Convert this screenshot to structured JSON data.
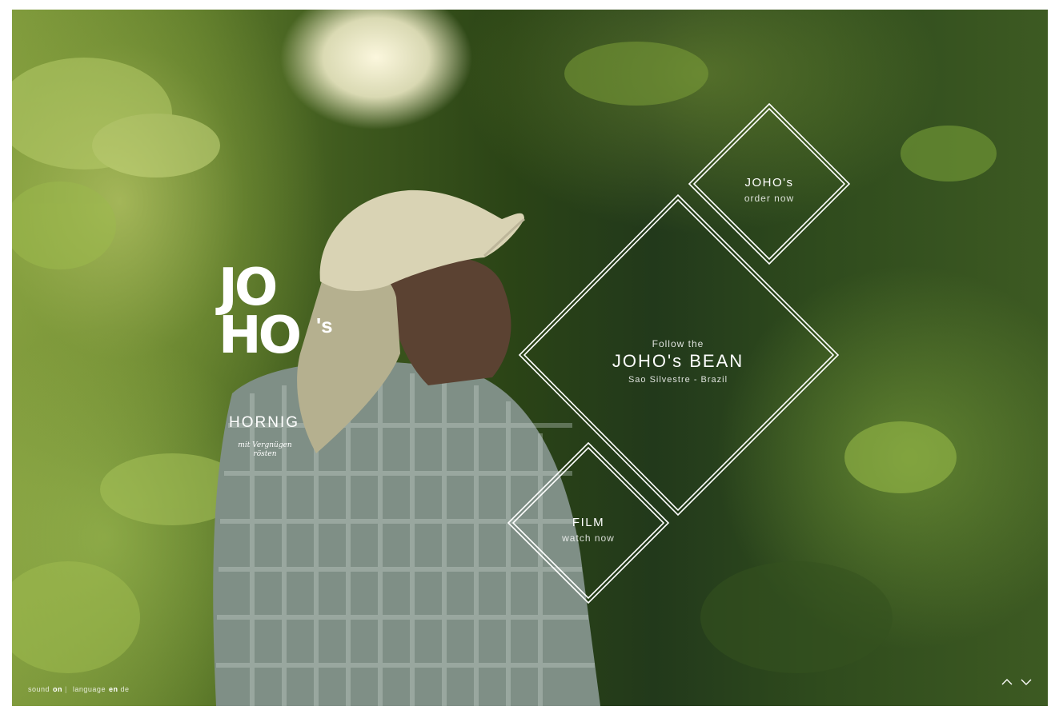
{
  "logo": {
    "line1": "JO",
    "line2": "HO",
    "suffix": "'s",
    "brand": "HORNIG",
    "tagline": "mit Vergnügen rösten"
  },
  "tiles": {
    "order": {
      "title": "JOHO's",
      "subtitle": "order now"
    },
    "bean": {
      "pre": "Follow the",
      "title": "JOHO's BEAN",
      "subtitle": "Sao Silvestre - Brazil"
    },
    "film": {
      "title": "FILM",
      "subtitle": "watch now"
    }
  },
  "footer": {
    "sound_label": "sound",
    "sound_state": "on",
    "separator": "|",
    "language_label": "language",
    "lang_en": "en",
    "lang_de": "de"
  },
  "nav": {
    "up_icon": "chevron-up-icon",
    "down_icon": "chevron-down-icon"
  },
  "colors": {
    "overlay_line": "#ffffff",
    "foliage_dark": "#22391b",
    "foliage_light": "#a8c25a"
  }
}
